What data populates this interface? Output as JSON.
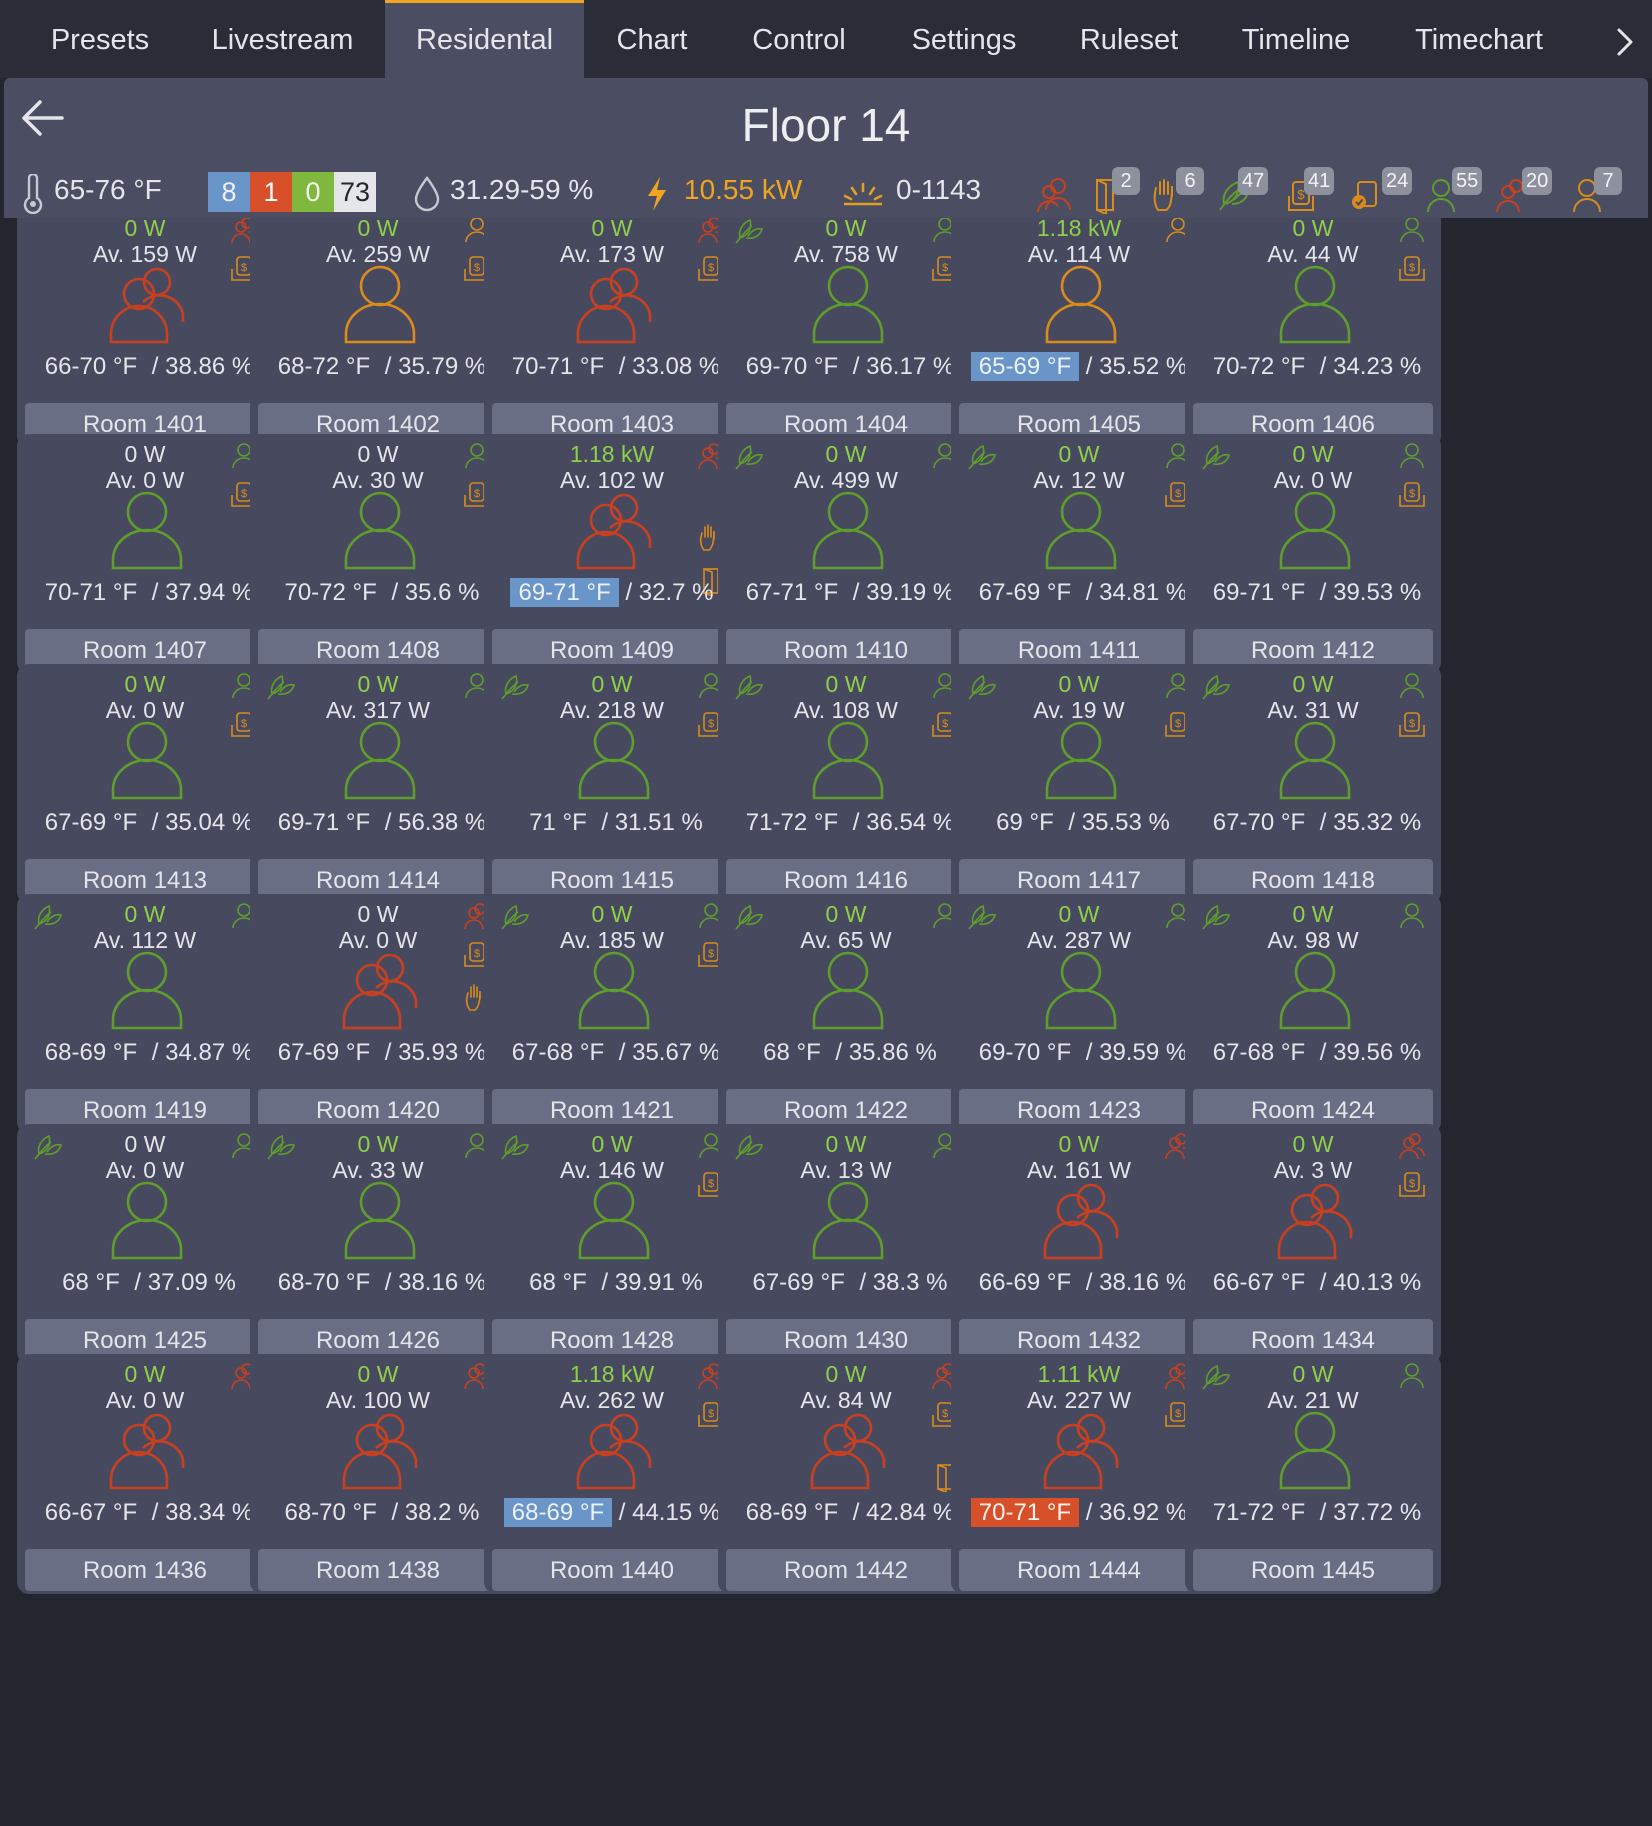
{
  "tabs": [
    "Presets",
    "Livestream",
    "Residental",
    "Chart",
    "Control",
    "Settings",
    "Ruleset",
    "Timeline",
    "Timechart"
  ],
  "active_tab": "Residental",
  "header": {
    "title": "Floor 14",
    "temp_range": "65-76 °F",
    "counts": {
      "blue": "8",
      "red": "1",
      "green": "0",
      "white": "73"
    },
    "humidity": "31.29-59 %",
    "power": "10.55 kW",
    "light": "0-1143",
    "badges": {
      "door": "2",
      "hand": "6",
      "eco": "47",
      "money": "41",
      "coin": "24",
      "occupied": "55",
      "multi": "20",
      "person": "7"
    }
  },
  "colors": {
    "green": "#5f9d2c",
    "orange": "#d98b1c",
    "red": "#c94020",
    "blue": "#6a95c8",
    "power_green": "#8fd04a",
    "power_orange": "#f0a420"
  },
  "rooms": [
    {
      "name": "Room 1401",
      "power": "0 W",
      "pon": true,
      "avg": "Av. 159 W",
      "temp": "66-70 °F",
      "hum": " / 38.86 %",
      "person": "red",
      "tr": "multi",
      "money": true
    },
    {
      "name": "Room 1402",
      "power": "0 W",
      "pon": true,
      "avg": "Av. 259 W",
      "temp": "68-72 °F",
      "hum": " / 35.79 %",
      "person": "orange",
      "tr": "person",
      "money": true
    },
    {
      "name": "Room 1403",
      "power": "0 W",
      "pon": true,
      "avg": "Av. 173 W",
      "temp": "70-71 °F",
      "hum": " / 33.08 %",
      "person": "red",
      "tr": "multi",
      "money": true
    },
    {
      "name": "Room 1404",
      "power": "0 W",
      "pon": true,
      "avg": "Av. 758 W",
      "temp": "69-70 °F",
      "hum": " / 36.17 %",
      "person": "green",
      "tr": "person",
      "money": true,
      "eco": true
    },
    {
      "name": "Room 1405",
      "power": "1.18 kW",
      "pon": true,
      "avg": "Av. 114 W",
      "temp": "65-69 °F",
      "hum": " / 35.52 %",
      "person": "orange",
      "tr": "person",
      "hl": "blue"
    },
    {
      "name": "Room 1406",
      "power": "0 W",
      "pon": true,
      "avg": "Av. 44 W",
      "temp": "70-72 °F",
      "hum": " / 34.23 %",
      "person": "green",
      "tr": "person",
      "money": true
    },
    {
      "name": "Room 1407",
      "power": "0 W",
      "pon": false,
      "avg": "Av. 0 W",
      "temp": "70-71 °F",
      "hum": " / 37.94 %",
      "person": "green",
      "tr": "person",
      "money": true
    },
    {
      "name": "Room 1408",
      "power": "0 W",
      "pon": false,
      "avg": "Av. 30 W",
      "temp": "70-72 °F",
      "hum": " / 35.6 %",
      "person": "green",
      "tr": "person",
      "money": true
    },
    {
      "name": "Room 1409",
      "power": "1.18 kW",
      "pon": true,
      "avg": "Av. 102 W",
      "temp": "69-71 °F",
      "hum": " / 32.7 %",
      "person": "red",
      "tr": "multi",
      "hand": true,
      "door": true,
      "hl": "blue"
    },
    {
      "name": "Room 1410",
      "power": "0 W",
      "pon": true,
      "avg": "Av. 499 W",
      "temp": "67-71 °F",
      "hum": " / 39.19 %",
      "person": "green",
      "tr": "person",
      "eco": true
    },
    {
      "name": "Room 1411",
      "power": "0 W",
      "pon": true,
      "avg": "Av. 12 W",
      "temp": "67-69 °F",
      "hum": " / 34.81 %",
      "person": "green",
      "tr": "person",
      "money": true,
      "eco": true
    },
    {
      "name": "Room 1412",
      "power": "0 W",
      "pon": true,
      "avg": "Av. 0 W",
      "temp": "69-71 °F",
      "hum": " / 39.53 %",
      "person": "green",
      "tr": "person",
      "money": true,
      "eco": true
    },
    {
      "name": "Room 1413",
      "power": "0 W",
      "pon": true,
      "avg": "Av. 0 W",
      "temp": "67-69 °F",
      "hum": " / 35.04 %",
      "person": "green",
      "tr": "person",
      "money": true
    },
    {
      "name": "Room 1414",
      "power": "0 W",
      "pon": true,
      "avg": "Av. 317 W",
      "temp": "69-71 °F",
      "hum": " / 56.38 %",
      "person": "green",
      "tr": "person",
      "eco": true
    },
    {
      "name": "Room 1415",
      "power": "0 W",
      "pon": true,
      "avg": "Av. 218 W",
      "temp": "71 °F",
      "hum": " / 31.51 %",
      "person": "green",
      "tr": "person",
      "money": true,
      "eco": true
    },
    {
      "name": "Room 1416",
      "power": "0 W",
      "pon": true,
      "avg": "Av. 108 W",
      "temp": "71-72 °F",
      "hum": " / 36.54 %",
      "person": "green",
      "tr": "person",
      "money": true,
      "eco": true
    },
    {
      "name": "Room 1417",
      "power": "0 W",
      "pon": true,
      "avg": "Av. 19 W",
      "temp": "69 °F",
      "hum": " / 35.53 %",
      "person": "green",
      "tr": "person",
      "money": true,
      "eco": true
    },
    {
      "name": "Room 1418",
      "power": "0 W",
      "pon": true,
      "avg": "Av. 31 W",
      "temp": "67-70 °F",
      "hum": " / 35.32 %",
      "person": "green",
      "tr": "person",
      "money": true,
      "eco": true
    },
    {
      "name": "Room 1419",
      "power": "0 W",
      "pon": true,
      "avg": "Av. 112 W",
      "temp": "68-69 °F",
      "hum": " / 34.87 %",
      "person": "green",
      "tr": "person",
      "eco": true
    },
    {
      "name": "Room 1420",
      "power": "0 W",
      "pon": false,
      "avg": "Av. 0 W",
      "temp": "67-69 °F",
      "hum": " / 35.93 %",
      "person": "red",
      "tr": "multi",
      "money": true,
      "hand": true
    },
    {
      "name": "Room 1421",
      "power": "0 W",
      "pon": true,
      "avg": "Av. 185 W",
      "temp": "67-68 °F",
      "hum": " / 35.67 %",
      "person": "green",
      "tr": "person",
      "money": true,
      "eco": true
    },
    {
      "name": "Room 1422",
      "power": "0 W",
      "pon": true,
      "avg": "Av. 65 W",
      "temp": "68 °F",
      "hum": " / 35.86 %",
      "person": "green",
      "tr": "person",
      "eco": true
    },
    {
      "name": "Room 1423",
      "power": "0 W",
      "pon": true,
      "avg": "Av. 287 W",
      "temp": "69-70 °F",
      "hum": " / 39.59 %",
      "person": "green",
      "tr": "person",
      "eco": true
    },
    {
      "name": "Room 1424",
      "power": "0 W",
      "pon": true,
      "avg": "Av. 98 W",
      "temp": "67-68 °F",
      "hum": " / 39.56 %",
      "person": "green",
      "tr": "person",
      "eco": true
    },
    {
      "name": "Room 1425",
      "power": "0 W",
      "pon": false,
      "avg": "Av. 0 W",
      "temp": "68 °F",
      "hum": " / 37.09 %",
      "person": "green",
      "tr": "person",
      "eco": true
    },
    {
      "name": "Room 1426",
      "power": "0 W",
      "pon": true,
      "avg": "Av. 33 W",
      "temp": "68-70 °F",
      "hum": " / 38.16 %",
      "person": "green",
      "tr": "person",
      "eco": true
    },
    {
      "name": "Room 1428",
      "power": "0 W",
      "pon": true,
      "avg": "Av. 146 W",
      "temp": "68 °F",
      "hum": " / 39.91 %",
      "person": "green",
      "tr": "person",
      "money": true,
      "eco": true
    },
    {
      "name": "Room 1430",
      "power": "0 W",
      "pon": true,
      "avg": "Av. 13 W",
      "temp": "67-69 °F",
      "hum": " / 38.3 %",
      "person": "green",
      "tr": "person",
      "eco": true
    },
    {
      "name": "Room 1432",
      "power": "0 W",
      "pon": true,
      "avg": "Av. 161 W",
      "temp": "66-69 °F",
      "hum": " / 38.16 %",
      "person": "red",
      "tr": "multi"
    },
    {
      "name": "Room 1434",
      "power": "0 W",
      "pon": true,
      "avg": "Av. 3 W",
      "temp": "66-67 °F",
      "hum": " / 40.13 %",
      "person": "red",
      "tr": "multi",
      "money": true
    },
    {
      "name": "Room 1436",
      "power": "0 W",
      "pon": true,
      "avg": "Av. 0 W",
      "temp": "66-67 °F",
      "hum": " / 38.34 %",
      "person": "red",
      "tr": "multi"
    },
    {
      "name": "Room 1438",
      "power": "0 W",
      "pon": true,
      "avg": "Av. 100 W",
      "temp": "68-70 °F",
      "hum": " / 38.2 %",
      "person": "red",
      "tr": "multi"
    },
    {
      "name": "Room 1440",
      "power": "1.18 kW",
      "pon": true,
      "avg": "Av. 262 W",
      "temp": "68-69 °F",
      "hum": " / 44.15 %",
      "person": "red",
      "tr": "multi",
      "money": true,
      "hl": "blue"
    },
    {
      "name": "Room 1442",
      "power": "0 W",
      "pon": true,
      "avg": "Av. 84 W",
      "temp": "68-69 °F",
      "hum": " / 42.84 %",
      "person": "red",
      "tr": "multi",
      "money": true,
      "door": true
    },
    {
      "name": "Room 1444",
      "power": "1.11 kW",
      "pon": true,
      "avg": "Av. 227 W",
      "temp": "70-71 °F",
      "hum": " / 36.92 %",
      "person": "red",
      "tr": "multi",
      "money": true,
      "hl": "red"
    },
    {
      "name": "Room 1445",
      "power": "0 W",
      "pon": true,
      "avg": "Av. 21 W",
      "temp": "71-72 °F",
      "hum": " / 37.72 %",
      "person": "green",
      "tr": "person",
      "eco": true
    }
  ]
}
